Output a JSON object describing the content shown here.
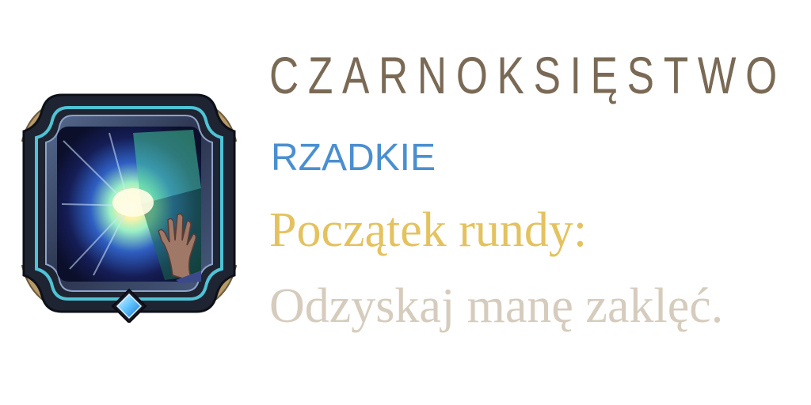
{
  "augment": {
    "title": "CZARNOKSIĘSTWO",
    "rarity": "RZADKIE",
    "trigger": "Początek rundy:",
    "effect": "Odzyskaj manę zaklęć."
  },
  "colors": {
    "title": "#7a6a55",
    "rarity": "#4a8fd0",
    "trigger": "#e4c25f",
    "effect": "#d6ccbd",
    "frame_dark": "#1f2432",
    "frame_gold": "#b79a68",
    "frame_teal": "#4fc3d6",
    "gem": "#66c8ff"
  },
  "icon": {
    "name": "sorcery-burst-icon",
    "gem_name": "rarity-gem-icon"
  }
}
